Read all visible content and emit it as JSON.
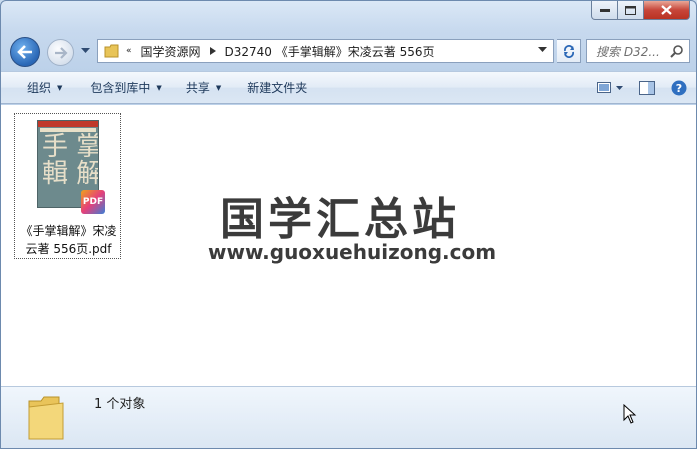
{
  "window": {
    "caption_buttons": [
      "minimize",
      "maximize",
      "close"
    ]
  },
  "address_bar": {
    "overflow_glyph": "«",
    "crumbs": [
      "国学资源网",
      "D32740 《手掌辑解》宋凌云著 556页"
    ],
    "search_placeholder": "搜索 D32..."
  },
  "toolbar": {
    "organize": "组织",
    "include_in_library": "包含到库中",
    "share": "共享",
    "new_folder": "新建文件夹"
  },
  "content": {
    "file": {
      "name": "《手掌辑解》宋凌云著 556页.pdf",
      "name_line1": "《手掌辑解》宋凌",
      "name_line2": "云著 556页.pdf",
      "cover_chars": "手 掌\n輯 解",
      "badge": "PDF"
    },
    "watermark_title": "国学汇总站",
    "watermark_url": "www.guoxuehuizong.com"
  },
  "details": {
    "object_count": "1 个对象"
  },
  "colors": {
    "accent": "#2a67b6",
    "toolbar_text": "#1e395b",
    "close_red": "#c7463a"
  }
}
